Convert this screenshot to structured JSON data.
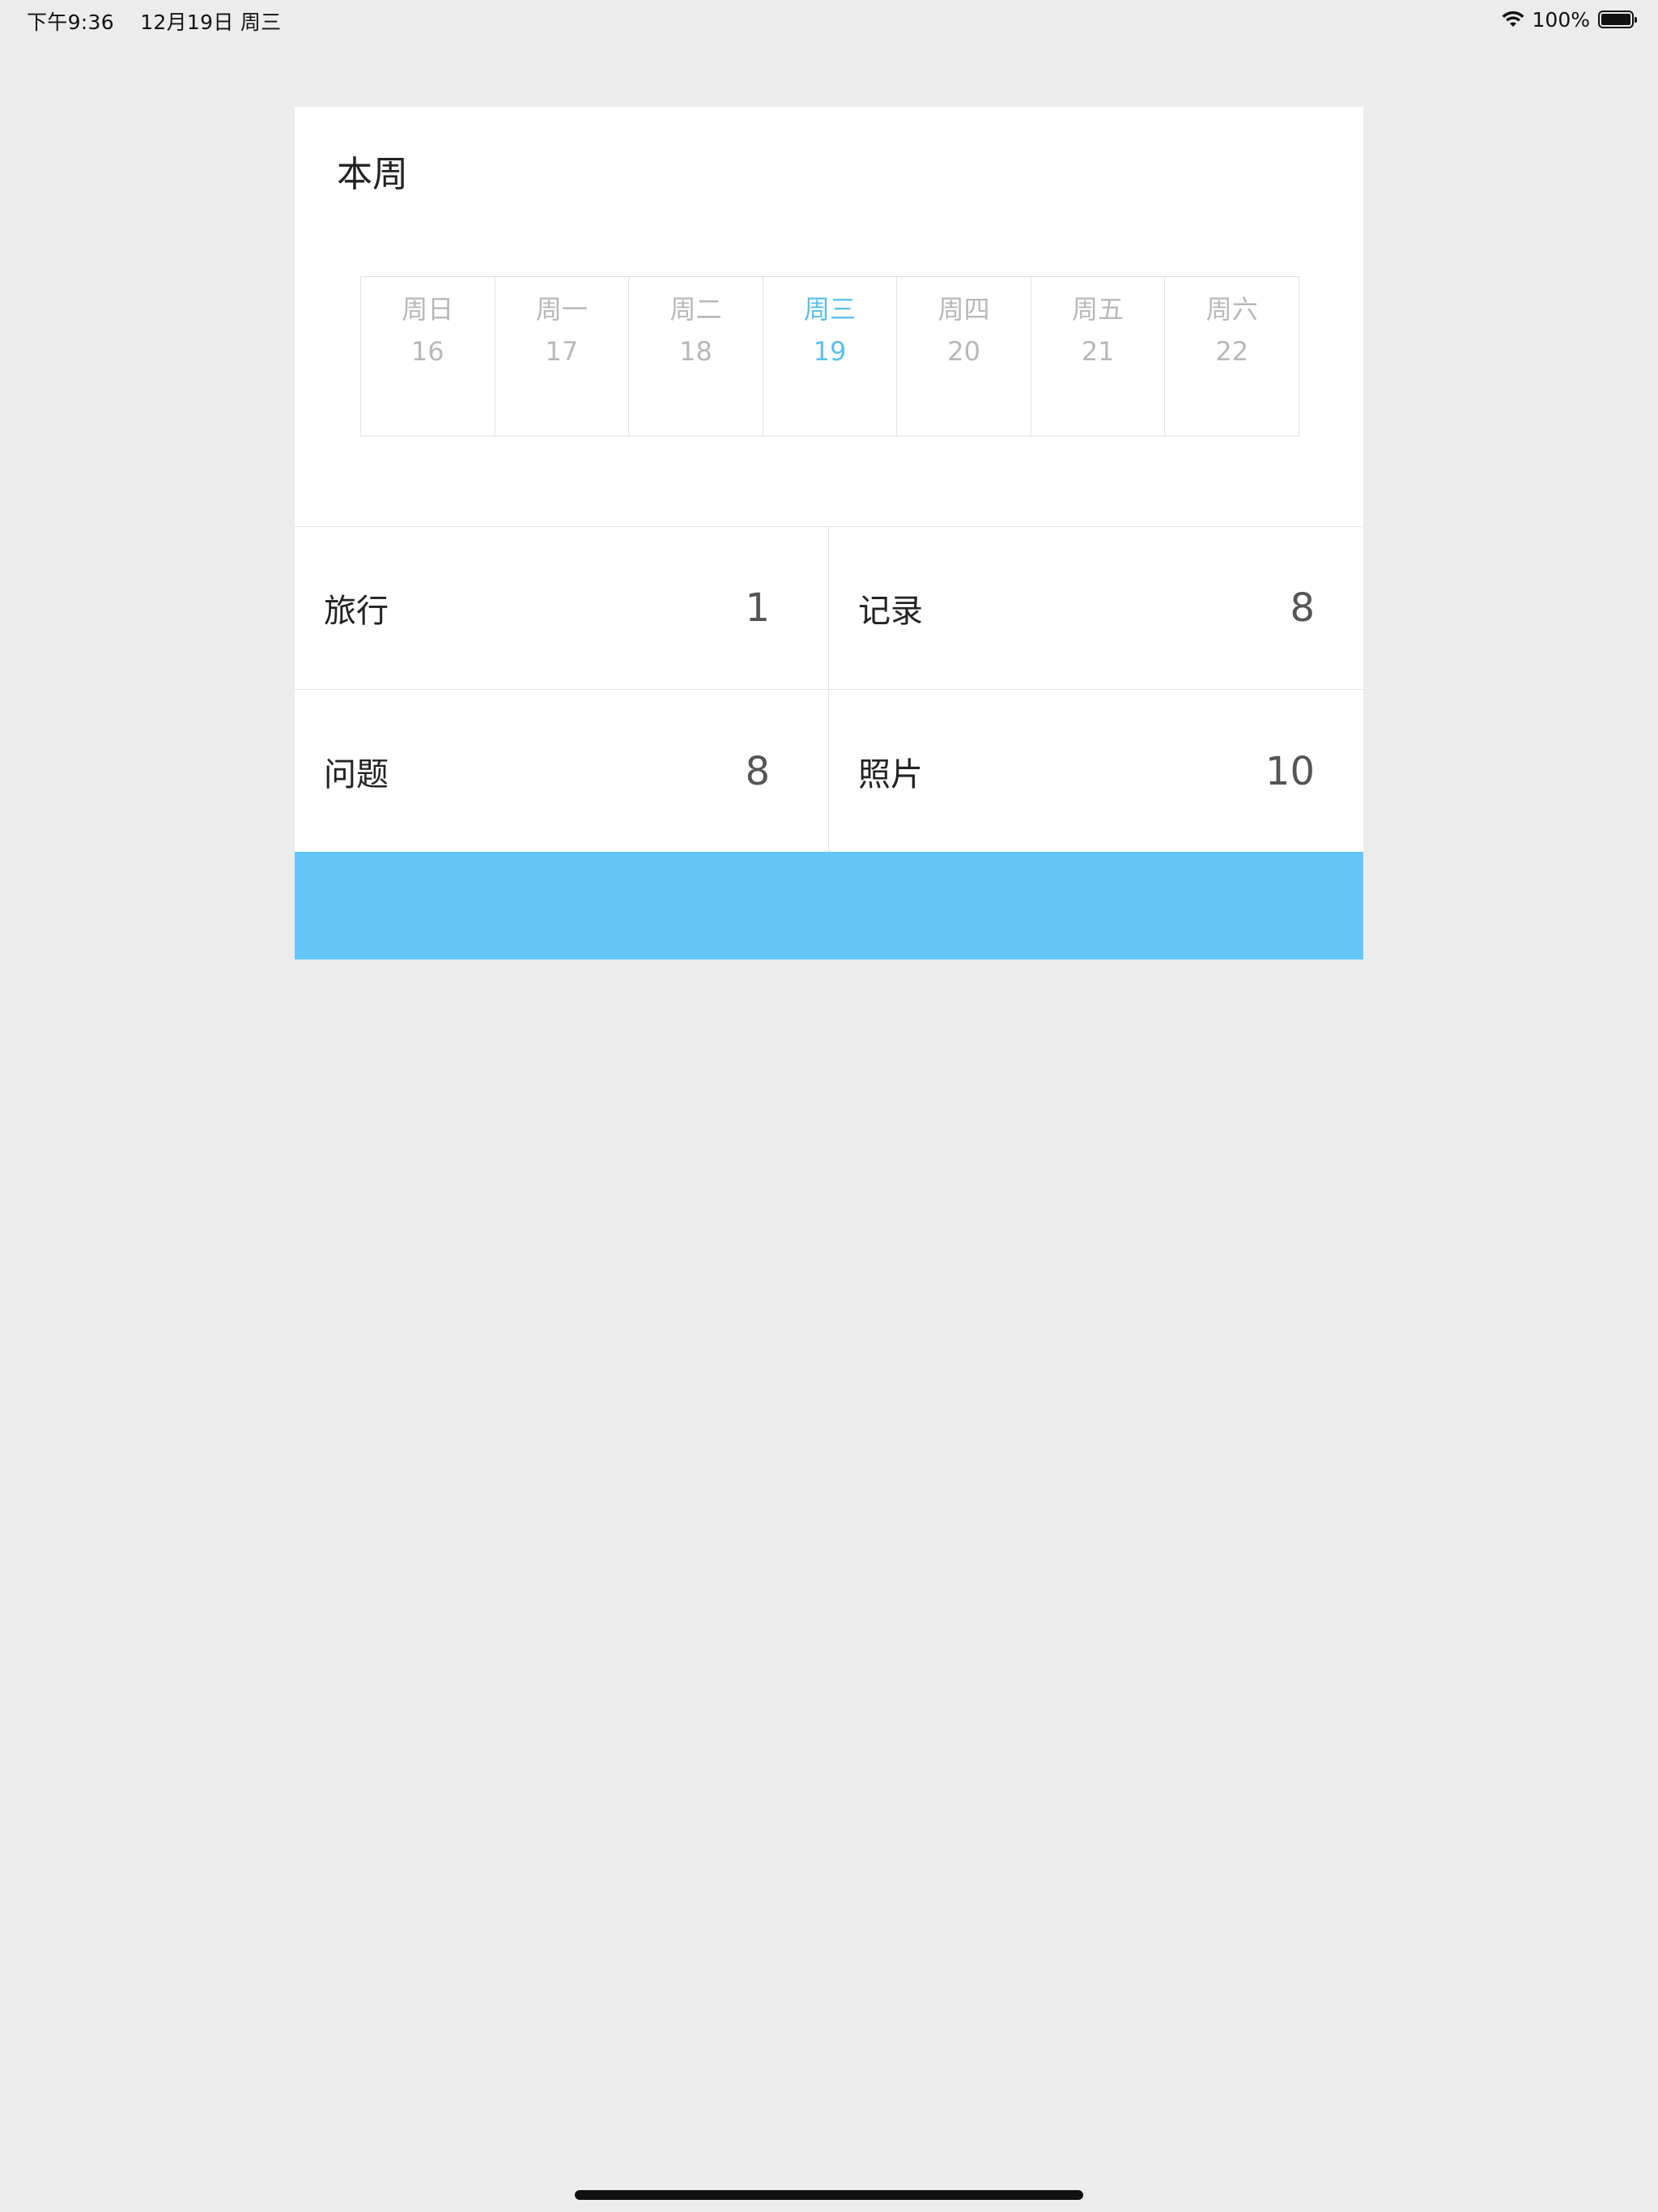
{
  "status_bar": {
    "time": "下午9:36",
    "date": "12月19日 周三",
    "battery_text": "100%",
    "battery_level": 1.0,
    "icons": [
      "wifi-icon",
      "battery-icon"
    ]
  },
  "week": {
    "title": "本周",
    "days": [
      {
        "name": "周日",
        "num": "16"
      },
      {
        "name": "周一",
        "num": "17"
      },
      {
        "name": "周二",
        "num": "18"
      },
      {
        "name": "周三",
        "num": "19"
      },
      {
        "name": "周四",
        "num": "20"
      },
      {
        "name": "周五",
        "num": "21"
      },
      {
        "name": "周六",
        "num": "22"
      }
    ],
    "active_index": 3
  },
  "stats": [
    {
      "label": "旅行",
      "value": "1"
    },
    {
      "label": "记录",
      "value": "8"
    },
    {
      "label": "问题",
      "value": "8"
    },
    {
      "label": "照片",
      "value": "10"
    }
  ],
  "colors": {
    "accent": "#5BC0EB",
    "bar": "#63C6F7",
    "background": "#ECECEC",
    "card": "#FFFFFF"
  }
}
